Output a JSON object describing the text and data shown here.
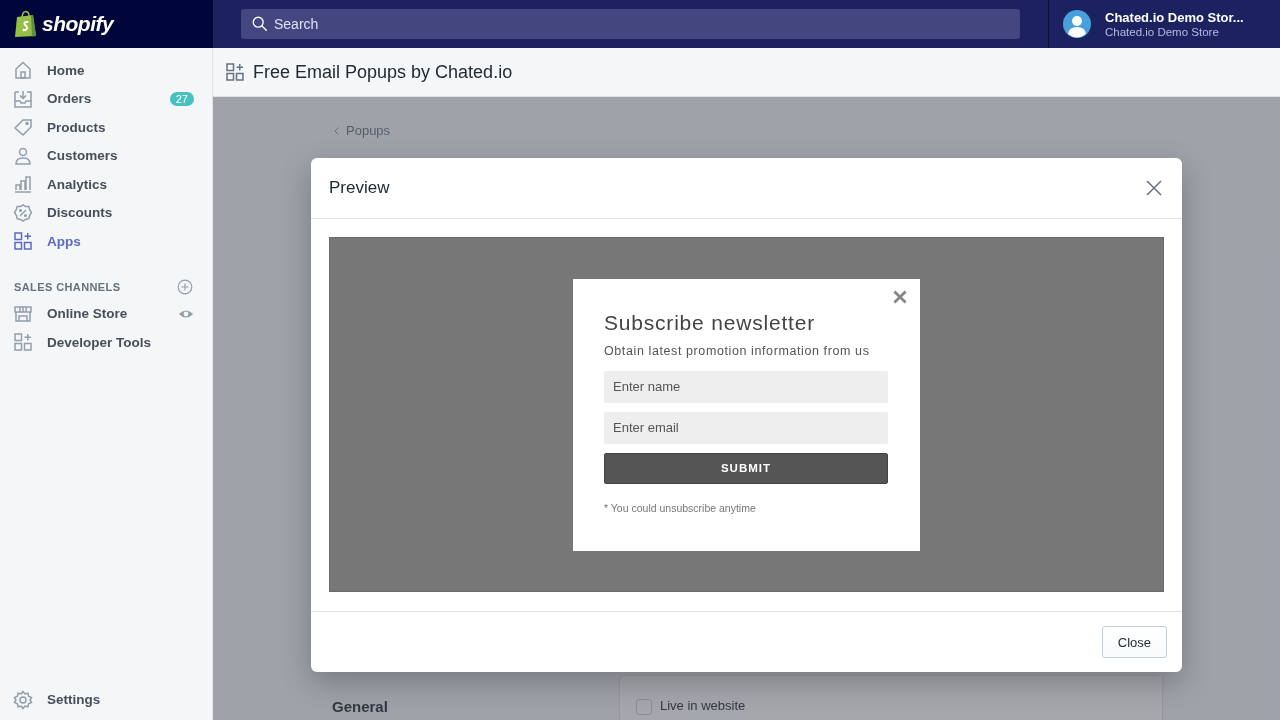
{
  "top_bar": {
    "logo": "shopify",
    "search": {
      "placeholder": "Search"
    },
    "account": {
      "name": "Chated.io Demo Stor...",
      "store": "Chated.io Demo Store"
    }
  },
  "sidebar": {
    "items": [
      {
        "label": "Home",
        "selected": false
      },
      {
        "label": "Orders",
        "badge": "27",
        "selected": false
      },
      {
        "label": "Products",
        "selected": false
      },
      {
        "label": "Customers",
        "selected": false
      },
      {
        "label": "Analytics",
        "selected": false
      },
      {
        "label": "Discounts",
        "selected": false
      },
      {
        "label": "Apps",
        "selected": true
      }
    ],
    "sales_channels": {
      "title": "SALES CHANNELS",
      "items": [
        {
          "label": "Online Store",
          "selected": false
        },
        {
          "label": "Developer Tools",
          "selected": false
        }
      ]
    },
    "settings": {
      "label": "Settings",
      "selected": false
    }
  },
  "app_header": {
    "title": "Free Email Popups by Chated.io"
  },
  "page": {
    "breadcrumb": "Popups",
    "section_title": "General",
    "checkbox": {
      "label": "Live in website",
      "checked": false
    }
  },
  "modal": {
    "title": "Preview",
    "popup": {
      "title": "Subscribe newsletter",
      "subtitle": "Obtain latest promotion information from us",
      "fields": [
        {
          "placeholder": "Enter name"
        },
        {
          "placeholder": "Enter email"
        }
      ],
      "submit": "SUBMIT",
      "note": "* You could unsubscribe anytime"
    },
    "buttons": [
      "Close"
    ]
  }
}
